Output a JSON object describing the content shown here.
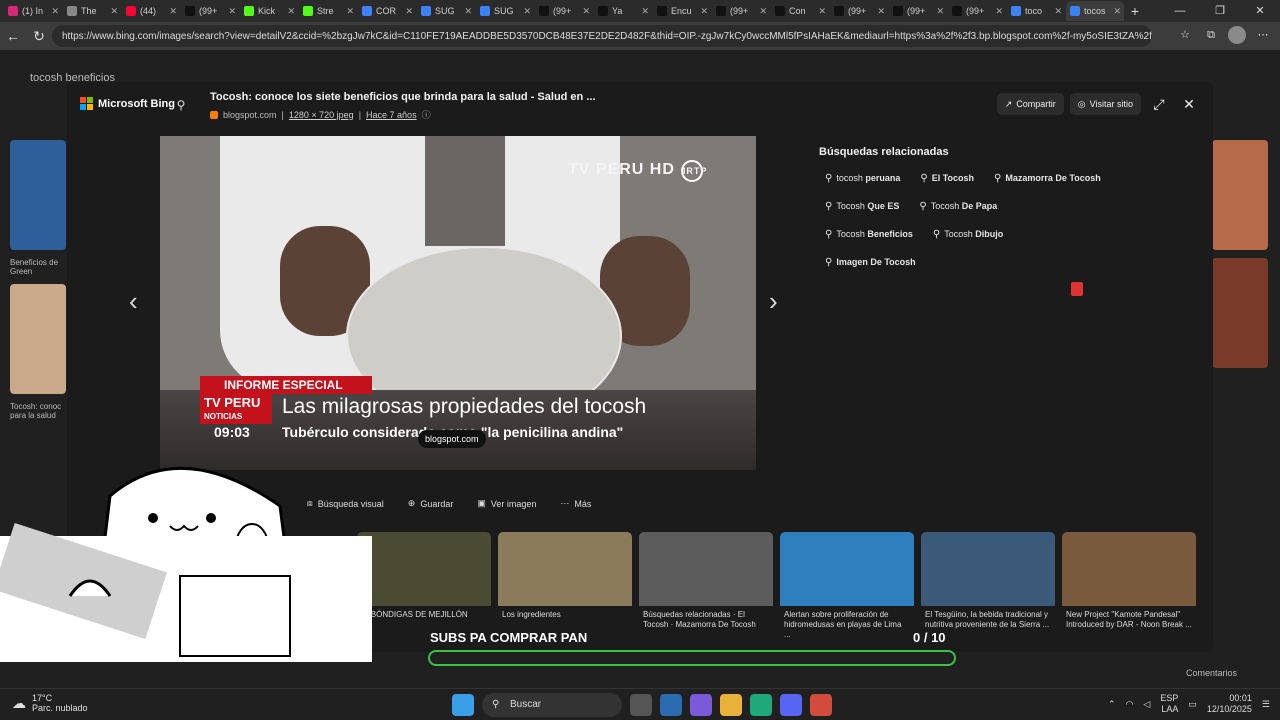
{
  "browser": {
    "tabs": [
      {
        "label": "(1) In",
        "icon": "instagram-icon",
        "color": "#d62976"
      },
      {
        "label": "The",
        "icon": "chatgpt-icon",
        "color": "#888888"
      },
      {
        "label": "(44)",
        "icon": "youtube-icon",
        "color": "#ff0033"
      },
      {
        "label": "(99+",
        "icon": "tiktok-icon",
        "color": "#111111"
      },
      {
        "label": "Kick",
        "icon": "kick-icon",
        "color": "#53fc18"
      },
      {
        "label": "Stre",
        "icon": "kick-icon",
        "color": "#53fc18"
      },
      {
        "label": "COR",
        "icon": "bing-search-icon",
        "color": "#3b82f6"
      },
      {
        "label": "SUG",
        "icon": "bing-search-icon",
        "color": "#3b82f6"
      },
      {
        "label": "SUG",
        "icon": "bing-search-icon",
        "color": "#3b82f6"
      },
      {
        "label": "(99+",
        "icon": "tiktok-icon",
        "color": "#111111"
      },
      {
        "label": "Ya",
        "icon": "tiktok-icon",
        "color": "#111111"
      },
      {
        "label": "Encu",
        "icon": "tiktok-icon",
        "color": "#111111"
      },
      {
        "label": "(99+",
        "icon": "tiktok-icon",
        "color": "#111111"
      },
      {
        "label": "Con",
        "icon": "tiktok-icon",
        "color": "#111111"
      },
      {
        "label": "(99+",
        "icon": "tiktok-icon",
        "color": "#111111"
      },
      {
        "label": "(99+",
        "icon": "tiktok-icon",
        "color": "#111111"
      },
      {
        "label": "(99+",
        "icon": "tiktok-icon",
        "color": "#111111"
      },
      {
        "label": "toco",
        "icon": "bing-search-icon",
        "color": "#3b82f6"
      },
      {
        "label": "tocos",
        "icon": "bing-search-icon",
        "color": "#3b82f6",
        "active": true
      }
    ],
    "new_tab": "+",
    "url": "https://www.bing.com/images/search?view=detailV2&ccid=%2bzgJw7kC&id=C110FE719AEADDBE5D3570DCB48E37E2DE2D482F&thid=OIP.-zgJw7kCy0wccMMl5fPsIAHaEK&mediaurl=https%3a%2f%2f3.bp.blogspot.com%2f-my5oSIE3tZA%2fWtKolOJrtG..."
  },
  "background": {
    "query_text": "tocosh beneficios",
    "left_label_1": "Tocosh: conoc para la salud",
    "left_label_2": "Beneficios de Green"
  },
  "modal": {
    "brand": "Microsoft Bing",
    "title": "Tocosh: conoce los siete beneficios que brinda para la salud - Salud en ...",
    "source": "blogspot.com",
    "dimensions": "1280 × 720 jpeg",
    "age": "Hace 7 años",
    "share_label": "Compartir",
    "visit_label": "Visitar sitio"
  },
  "image": {
    "channel_logo": "TV PERU HD",
    "channel_badge": "IRTP",
    "informe": "INFORME ESPECIAL",
    "badge_top": "TV PERU",
    "badge_bottom": "NOTICIAS",
    "headline": "Las milagrosas propiedades del tocosh",
    "time": "09:03",
    "subline": "Tubérculo considerado como \"la penicilina andina\"",
    "source_badge": "blogspot.com"
  },
  "related": {
    "title": "Búsquedas relacionadas",
    "chips": [
      {
        "prefix": "tocosh ",
        "bold": "peruana"
      },
      {
        "prefix": "",
        "bold": "El Tocosh"
      },
      {
        "prefix": "",
        "bold": "Mazamorra De Tocosh"
      },
      {
        "prefix": "Tocosh ",
        "bold": "Que ES"
      },
      {
        "prefix": "Tocosh ",
        "bold": "De Papa"
      },
      {
        "prefix": "Tocosh ",
        "bold": "Beneficios"
      },
      {
        "prefix": "Tocosh ",
        "bold": "Dibujo"
      },
      {
        "prefix": "",
        "bold": "Imagen De Tocosh"
      }
    ]
  },
  "toolbar": {
    "visual": "Búsqueda visual",
    "save": "Guardar",
    "view": "Ver imagen",
    "more": "Más"
  },
  "strip": [
    {
      "caption": "ALBÓNDIGAS DE MEJILLÓN",
      "color": "#4b4a33"
    },
    {
      "caption": "Los ingredientes",
      "color": "#8b7b5a"
    },
    {
      "caption": "Búsquedas relacionadas · El Tocosh · Mazamorra De Tocosh",
      "color": "#5c5c5c"
    },
    {
      "caption": "Alertan sobre proliferación de hidromedusas en playas de Lima ...",
      "color": "#2f7fbf"
    },
    {
      "caption": "El Tesgüino, la bebida tradicional y nutritiva proveniente de la Sierra ...",
      "color": "#3b5a7a"
    },
    {
      "caption": "New Project \"Kamote Pandesal\" Introduced by DAR - Noon Break ...",
      "color": "#7a5a3c"
    }
  ],
  "overlay": {
    "subs": "SUBS PA COMPRAR PAN",
    "counter": "0 / 10",
    "accent": "#38c24a"
  },
  "taskbar": {
    "temp": "17°C",
    "weather": "Parc. nublado",
    "search": "Buscar",
    "lang_top": "ESP",
    "lang_bottom": "LAA",
    "time": "00:01",
    "date": "12/10/2025",
    "comments": "Comentarios"
  }
}
